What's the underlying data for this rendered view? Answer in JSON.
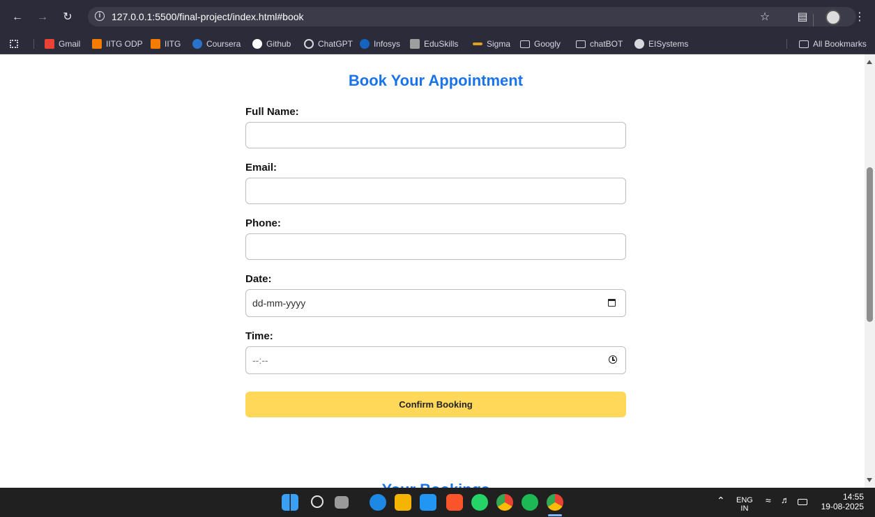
{
  "browser": {
    "url": "127.0.0.1:5500/final-project/index.html#book",
    "bookmarks": [
      {
        "label": "Gmail",
        "icon": "gmail-icon"
      },
      {
        "label": "IITG ODP",
        "icon": "iitg-icon"
      },
      {
        "label": "IITG",
        "icon": "iitg-icon"
      },
      {
        "label": "Coursera",
        "icon": "coursera-icon"
      },
      {
        "label": "Github",
        "icon": "github-icon"
      },
      {
        "label": "ChatGPT",
        "icon": "chatgpt-icon"
      },
      {
        "label": "Infosys",
        "icon": "infosys-icon"
      },
      {
        "label": "EduSkills",
        "icon": "eduskills-icon"
      },
      {
        "label": "Sigma",
        "icon": "sigma-icon"
      },
      {
        "label": "Googly",
        "icon": "folder-icon"
      },
      {
        "label": "chatBOT",
        "icon": "folder-icon"
      },
      {
        "label": "EISystems",
        "icon": "globe-icon"
      }
    ],
    "all_bookmarks": "All Bookmarks"
  },
  "form": {
    "title": "Book Your Appointment",
    "fields": {
      "name_label": "Full Name:",
      "email_label": "Email:",
      "phone_label": "Phone:",
      "date_label": "Date:",
      "date_placeholder": "dd-mm-yyyy",
      "time_label": "Time:",
      "time_placeholder": "--:--"
    },
    "confirm_label": "Confirm Booking"
  },
  "next_section_heading": "Your Bookings",
  "taskbar": {
    "lang_top": "ENG",
    "lang_bottom": "IN",
    "time": "14:55",
    "date": "19-08-2025"
  },
  "colors": {
    "accent": "#1a73e8",
    "button": "#ffd85a",
    "chrome": "#2b2b3a"
  }
}
